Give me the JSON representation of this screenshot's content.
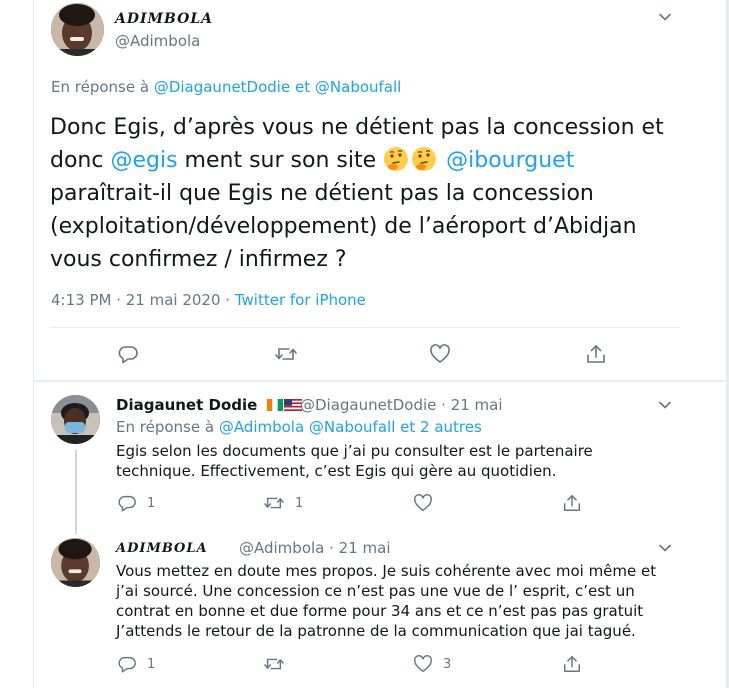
{
  "main_tweet": {
    "display_name": "ADIMBOLA",
    "handle": "@Adimbola",
    "reply_prefix": "En réponse à",
    "reply_to_1": "@DiagaunetDodie",
    "reply_sep": "et",
    "reply_to_2": "@Naboufall",
    "text_1": "Donc Egis, d’après vous ne détient pas la concession et",
    "text_2a": "donc",
    "mention_egis": "@egis",
    "text_2b": "ment sur son site",
    "mention_ibourguet": "@ibourguet",
    "text_3": "paraîtrait-il que Egis ne détient pas la concession",
    "text_4": "(exploitation/développement) de l’aéroport d’Abidjan",
    "text_5": "vous confirmez / infirmez ?",
    "emoji_name": "thinking-face",
    "time": "4:13 PM · 21 mai 2020 ·",
    "source": "Twitter for iPhone"
  },
  "replies": [
    {
      "display_name": "Diagaunet Dodie",
      "flags": [
        "cote-divoire-flag",
        "usa-flag"
      ],
      "handle": "@DiagaunetDodie · 21 mai",
      "reply_prefix": "En réponse à",
      "reply_to": "@Adimbola @Naboufall  et 2 autres",
      "text": "Egis selon les documents que j’ai pu consulter est le partenaire technique. Effectivement, c’est Egis qui gère au quotidien.",
      "reply_count": "1",
      "retweet_count": "1",
      "like_count": ""
    },
    {
      "display_name": "ADIMBOLA",
      "handle": "@Adimbola · 21 mai",
      "text": "Vous mettez en doute mes propos. Je suis cohérente avec moi même et j’ai sourcé. Une concession ce n’est pas une vue de l’ esprit, c’est un contrat en bonne et due forme pour 34 ans et ce n’est pas pas gratuit J’attends le retour de la patronne de la communication que jai tagué.",
      "reply_count": "1",
      "retweet_count": "",
      "like_count": "3"
    }
  ],
  "colors": {
    "link": "#1da1f2",
    "secondary": "#657786",
    "text": "#14171a",
    "border": "#e6ecf0"
  },
  "icons": [
    "reply-icon",
    "retweet-icon",
    "like-icon",
    "share-icon",
    "chevron-down-icon"
  ]
}
